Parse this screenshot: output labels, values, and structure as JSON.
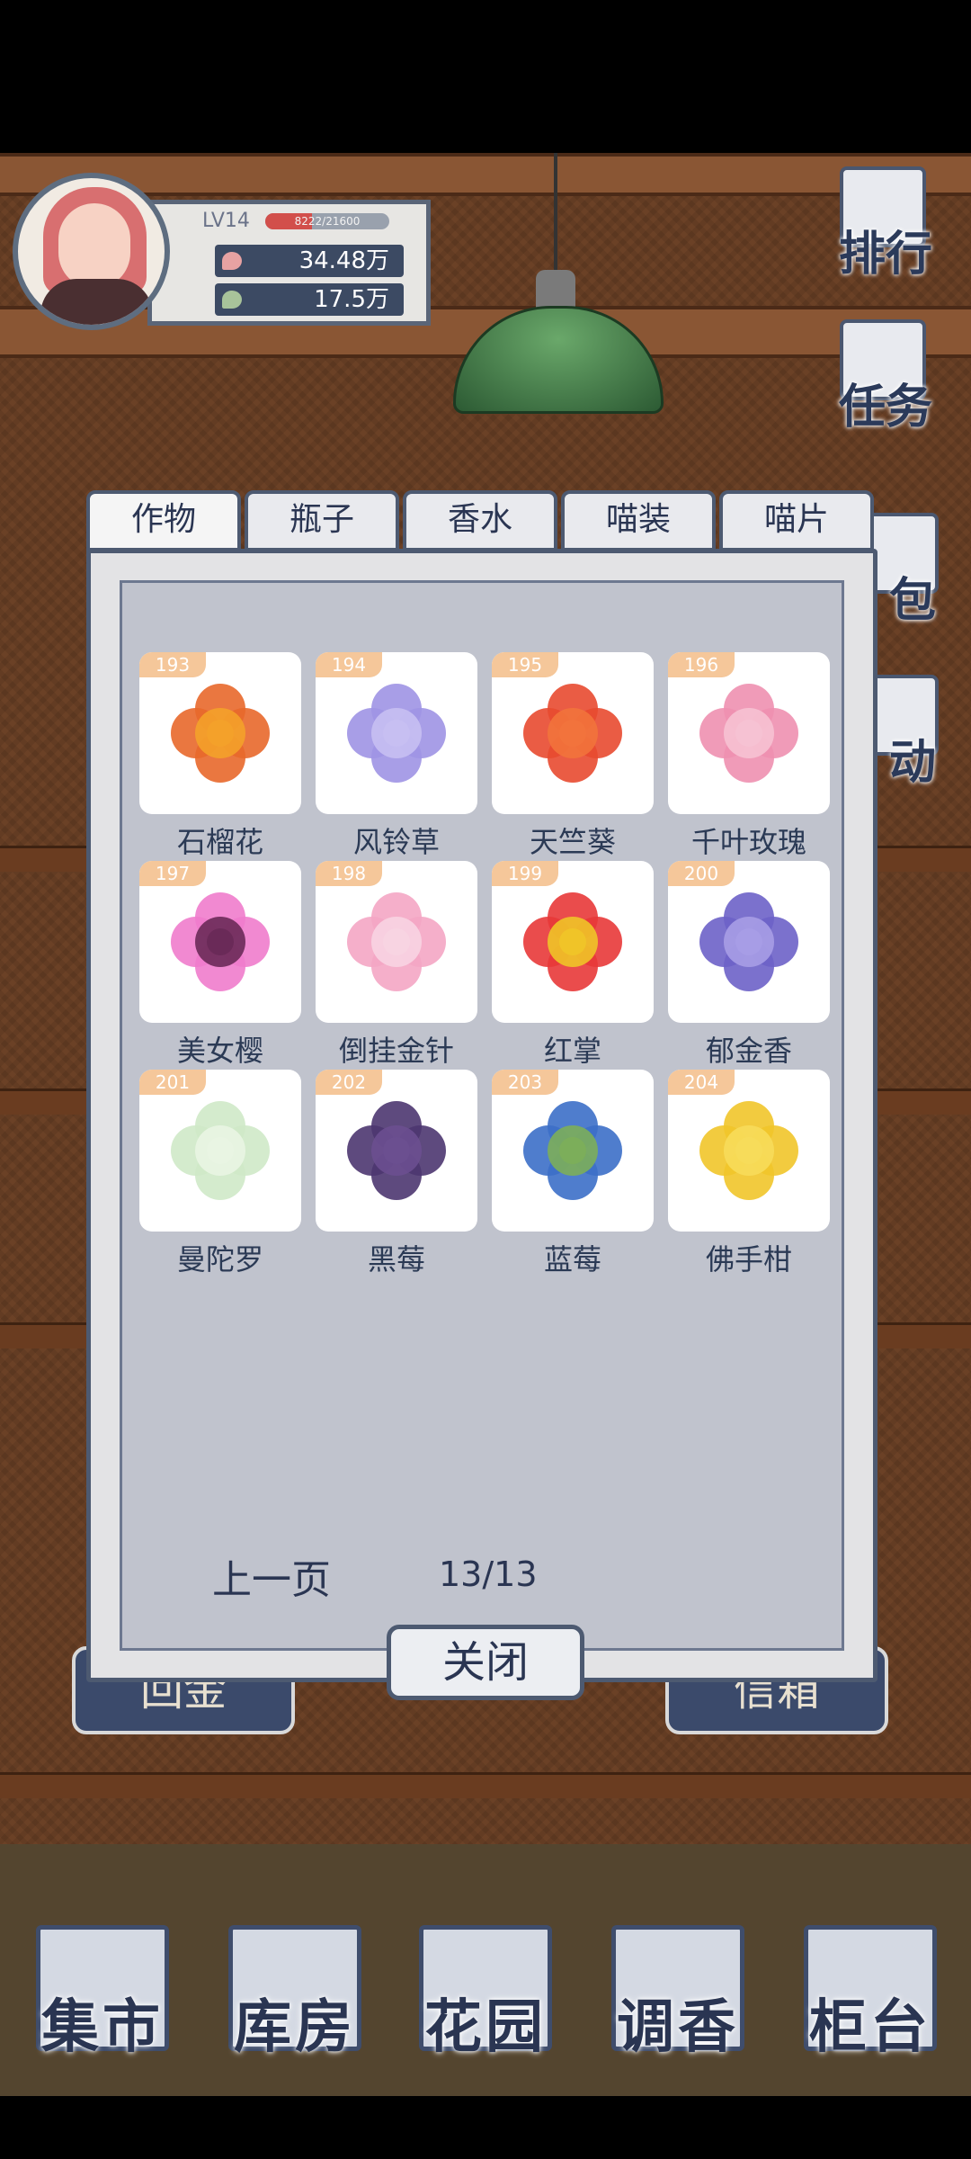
{
  "player": {
    "level": "LV14",
    "xp_text": "8222/21600",
    "xp_progress": 0.38,
    "currency_flower": "34.48万",
    "currency_leaf": "17.5万"
  },
  "sidebar": {
    "ranking": "排行",
    "tasks": "任务",
    "bag": "包",
    "activity": "动"
  },
  "dialog": {
    "tabs": [
      "作物",
      "瓶子",
      "香水",
      "喵装",
      "喵片"
    ],
    "active_tab": 0,
    "items": [
      {
        "id": "193",
        "name": "石榴花",
        "colors": [
          "#e8682b",
          "#f4a12a"
        ]
      },
      {
        "id": "194",
        "name": "风铃草",
        "colors": [
          "#9f93e4",
          "#c7bff2"
        ]
      },
      {
        "id": "195",
        "name": "天竺葵",
        "colors": [
          "#e84a30",
          "#f2733c"
        ]
      },
      {
        "id": "196",
        "name": "千叶玫瑰",
        "colors": [
          "#ee90b0",
          "#f6c2d3"
        ]
      },
      {
        "id": "197",
        "name": "美女樱",
        "colors": [
          "#f07ccc",
          "#6a2a58"
        ]
      },
      {
        "id": "198",
        "name": "倒挂金针",
        "colors": [
          "#f4a6c4",
          "#f8d4e2"
        ]
      },
      {
        "id": "199",
        "name": "红掌",
        "colors": [
          "#e83838",
          "#f0c428"
        ]
      },
      {
        "id": "200",
        "name": "郁金香",
        "colors": [
          "#6d62c8",
          "#a79de6"
        ]
      },
      {
        "id": "201",
        "name": "曼陀罗",
        "colors": [
          "#cfe9c8",
          "#e9f5e3"
        ]
      },
      {
        "id": "202",
        "name": "黑莓",
        "colors": [
          "#4c3670",
          "#6b4f90"
        ]
      },
      {
        "id": "203",
        "name": "蓝莓",
        "colors": [
          "#3c6fc8",
          "#7cae5a"
        ]
      },
      {
        "id": "204",
        "name": "佛手柑",
        "colors": [
          "#f1c52a",
          "#f7dc5a"
        ]
      }
    ],
    "prev_page": "上一页",
    "page_indicator": "13/13",
    "close": "关闭"
  },
  "signs": {
    "left": "回金",
    "right": "信箱"
  },
  "nav": [
    "集市",
    "库房",
    "花园",
    "调香",
    "柜台"
  ]
}
